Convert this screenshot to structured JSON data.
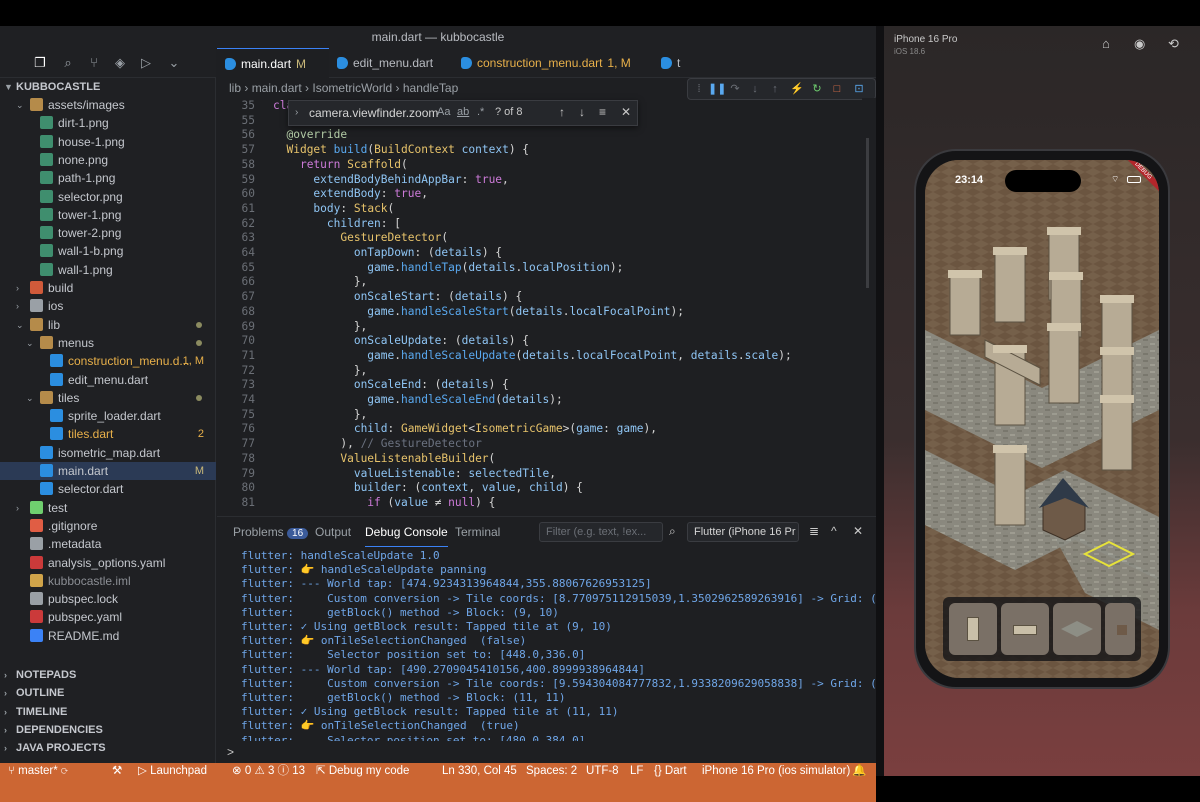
{
  "window": {
    "title": "main.dart — kubbocastle"
  },
  "explorer": {
    "root": "KUBBOCASTLE",
    "items": [
      {
        "label": "assets/images",
        "kind": "folder",
        "depth": 1,
        "open": true
      },
      {
        "label": "dirt-1.png",
        "kind": "img",
        "depth": 2
      },
      {
        "label": "house-1.png",
        "kind": "img",
        "depth": 2
      },
      {
        "label": "none.png",
        "kind": "img",
        "depth": 2
      },
      {
        "label": "path-1.png",
        "kind": "img",
        "depth": 2
      },
      {
        "label": "selector.png",
        "kind": "img",
        "depth": 2
      },
      {
        "label": "tower-1.png",
        "kind": "img",
        "depth": 2
      },
      {
        "label": "tower-2.png",
        "kind": "img",
        "depth": 2
      },
      {
        "label": "wall-1-b.png",
        "kind": "img",
        "depth": 2
      },
      {
        "label": "wall-1.png",
        "kind": "img",
        "depth": 2
      },
      {
        "label": "build",
        "kind": "folder-build",
        "depth": 1,
        "open": false
      },
      {
        "label": "ios",
        "kind": "folder-ios",
        "depth": 1,
        "open": false
      },
      {
        "label": "lib",
        "kind": "folder-lib",
        "depth": 1,
        "open": true,
        "dot": true
      },
      {
        "label": "menus",
        "kind": "folder",
        "depth": 2,
        "open": true,
        "dot": true
      },
      {
        "label": "construction_menu.d...",
        "kind": "dart",
        "depth": 3,
        "badge": "1, M",
        "color": "#e8b04a"
      },
      {
        "label": "edit_menu.dart",
        "kind": "dart",
        "depth": 3
      },
      {
        "label": "tiles",
        "kind": "folder",
        "depth": 2,
        "open": true,
        "dot": true
      },
      {
        "label": "sprite_loader.dart",
        "kind": "dart",
        "depth": 3
      },
      {
        "label": "tiles.dart",
        "kind": "dart",
        "depth": 3,
        "badge": "2",
        "color": "#e8b04a"
      },
      {
        "label": "isometric_map.dart",
        "kind": "dart",
        "depth": 2
      },
      {
        "label": "main.dart",
        "kind": "dart",
        "depth": 2,
        "badge": "M",
        "selected": true
      },
      {
        "label": "selector.dart",
        "kind": "dart",
        "depth": 2
      },
      {
        "label": "test",
        "kind": "folder-test",
        "depth": 1,
        "open": false
      },
      {
        "label": ".gitignore",
        "kind": "git",
        "depth": 1
      },
      {
        "label": ".metadata",
        "kind": "file",
        "depth": 1
      },
      {
        "label": "analysis_options.yaml",
        "kind": "yaml",
        "depth": 1
      },
      {
        "label": "kubbocastle.iml",
        "kind": "iml",
        "depth": 1,
        "color": "#8b8e94"
      },
      {
        "label": "pubspec.lock",
        "kind": "lock",
        "depth": 1
      },
      {
        "label": "pubspec.yaml",
        "kind": "yaml",
        "depth": 1
      },
      {
        "label": "README.md",
        "kind": "info",
        "depth": 1
      }
    ],
    "sections": [
      "NOTEPADS",
      "OUTLINE",
      "TIMELINE",
      "DEPENDENCIES",
      "JAVA PROJECTS"
    ]
  },
  "tabs": [
    {
      "label": "main.dart",
      "suffix": "M",
      "active": true
    },
    {
      "label": "edit_menu.dart",
      "suffix": ""
    },
    {
      "label": "construction_menu.dart",
      "suffix": "1, M",
      "color": "#e8b04a"
    },
    {
      "label": "t",
      "suffix": ""
    }
  ],
  "breadcrumb": [
    "lib",
    "main.dart",
    "IsometricWorld",
    "handleTap"
  ],
  "find": {
    "query": "camera.viewfinder.zoom",
    "opt1": "Aa",
    "opt2": "ab",
    "opt3": ".*",
    "result": "? of 8"
  },
  "code": [
    {
      "n": "35",
      "t": "class _GameScreenState extends State<G"
    },
    {
      "n": "55",
      "t": ""
    },
    {
      "n": "56",
      "t": "  @override"
    },
    {
      "n": "57",
      "t": "  Widget build(BuildContext context) {"
    },
    {
      "n": "58",
      "t": "    return Scaffold("
    },
    {
      "n": "59",
      "t": "      extendBodyBehindAppBar: true,"
    },
    {
      "n": "60",
      "t": "      extendBody: true,"
    },
    {
      "n": "61",
      "t": "      body: Stack("
    },
    {
      "n": "62",
      "t": "        children: ["
    },
    {
      "n": "63",
      "t": "          GestureDetector("
    },
    {
      "n": "64",
      "t": "            onTapDown: (details) {"
    },
    {
      "n": "65",
      "t": "              game.handleTap(details.localPosition);"
    },
    {
      "n": "66",
      "t": "            },"
    },
    {
      "n": "67",
      "t": "            onScaleStart: (details) {"
    },
    {
      "n": "68",
      "t": "              game.handleScaleStart(details.localFocalPoint);"
    },
    {
      "n": "69",
      "t": "            },"
    },
    {
      "n": "70",
      "t": "            onScaleUpdate: (details) {"
    },
    {
      "n": "71",
      "t": "              game.handleScaleUpdate(details.localFocalPoint, details.scale);"
    },
    {
      "n": "72",
      "t": "            },"
    },
    {
      "n": "73",
      "t": "            onScaleEnd: (details) {"
    },
    {
      "n": "74",
      "t": "              game.handleScaleEnd(details);"
    },
    {
      "n": "75",
      "t": "            },"
    },
    {
      "n": "76",
      "t": "            child: GameWidget<IsometricGame>(game: game),"
    },
    {
      "n": "77",
      "t": "          ), // GestureDetector"
    },
    {
      "n": "78",
      "t": "          ValueListenableBuilder("
    },
    {
      "n": "79",
      "t": "            valueListenable: selectedTile,"
    },
    {
      "n": "80",
      "t": "            builder: (context, value, child) {"
    },
    {
      "n": "81",
      "t": "              if (value ≠ null) {"
    }
  ],
  "panel": {
    "tabs": [
      "Problems",
      "Output",
      "Debug Console",
      "Terminal"
    ],
    "problems_count": "16",
    "filter_placeholder": "Filter (e.g. text, !ex...",
    "device": "Flutter (iPhone 16 Pr",
    "lines": [
      "flutter: handleScaleUpdate 1.0",
      "flutter: 👉 handleScaleUpdate panning",
      "flutter: --- World tap: [474.9234313964844,355.88067626953125]",
      "flutter:     Custom conversion -> Tile coords: [8.770975112915039,1.3502962589263916] -> Grid: (9, 1)",
      "flutter:     getBlock() method -> Block: (9, 10)",
      "flutter: ✓ Using getBlock result: Tapped tile at (9, 10)",
      "flutter: 👉 onTileSelectionChanged  (false)",
      "flutter:     Selector position set to: [448.0,336.0]",
      "flutter: --- World tap: [490.2709045410156,400.8999938964844]",
      "flutter:     Custom conversion -> Tile coords: [9.594304084777832,1.9338209629058838] -> Grid: (10, 2)",
      "flutter:     getBlock() method -> Block: (11, 11)",
      "flutter: ✓ Using getBlock result: Tapped tile at (11, 11)",
      "flutter: 👉 onTileSelectionChanged  (true)",
      "flutter:     Selector position set to: [480.0,384.0]"
    ],
    "prompt": ">"
  },
  "status": {
    "branch": "master*",
    "launch": "Launchpad",
    "errors": "0",
    "warnings": "3",
    "infos": "13",
    "debug": "Debug my code",
    "position": "Ln 330, Col 45",
    "spaces": "Spaces: 2",
    "encoding": "UTF-8",
    "eol": "LF",
    "lang": "Dart",
    "device": "iPhone 16 Pro (ios simulator)"
  },
  "simulator": {
    "device": "iPhone 16 Pro",
    "os": "iOS 18.6",
    "time": "23:14",
    "debug_banner": "DEBUG"
  }
}
